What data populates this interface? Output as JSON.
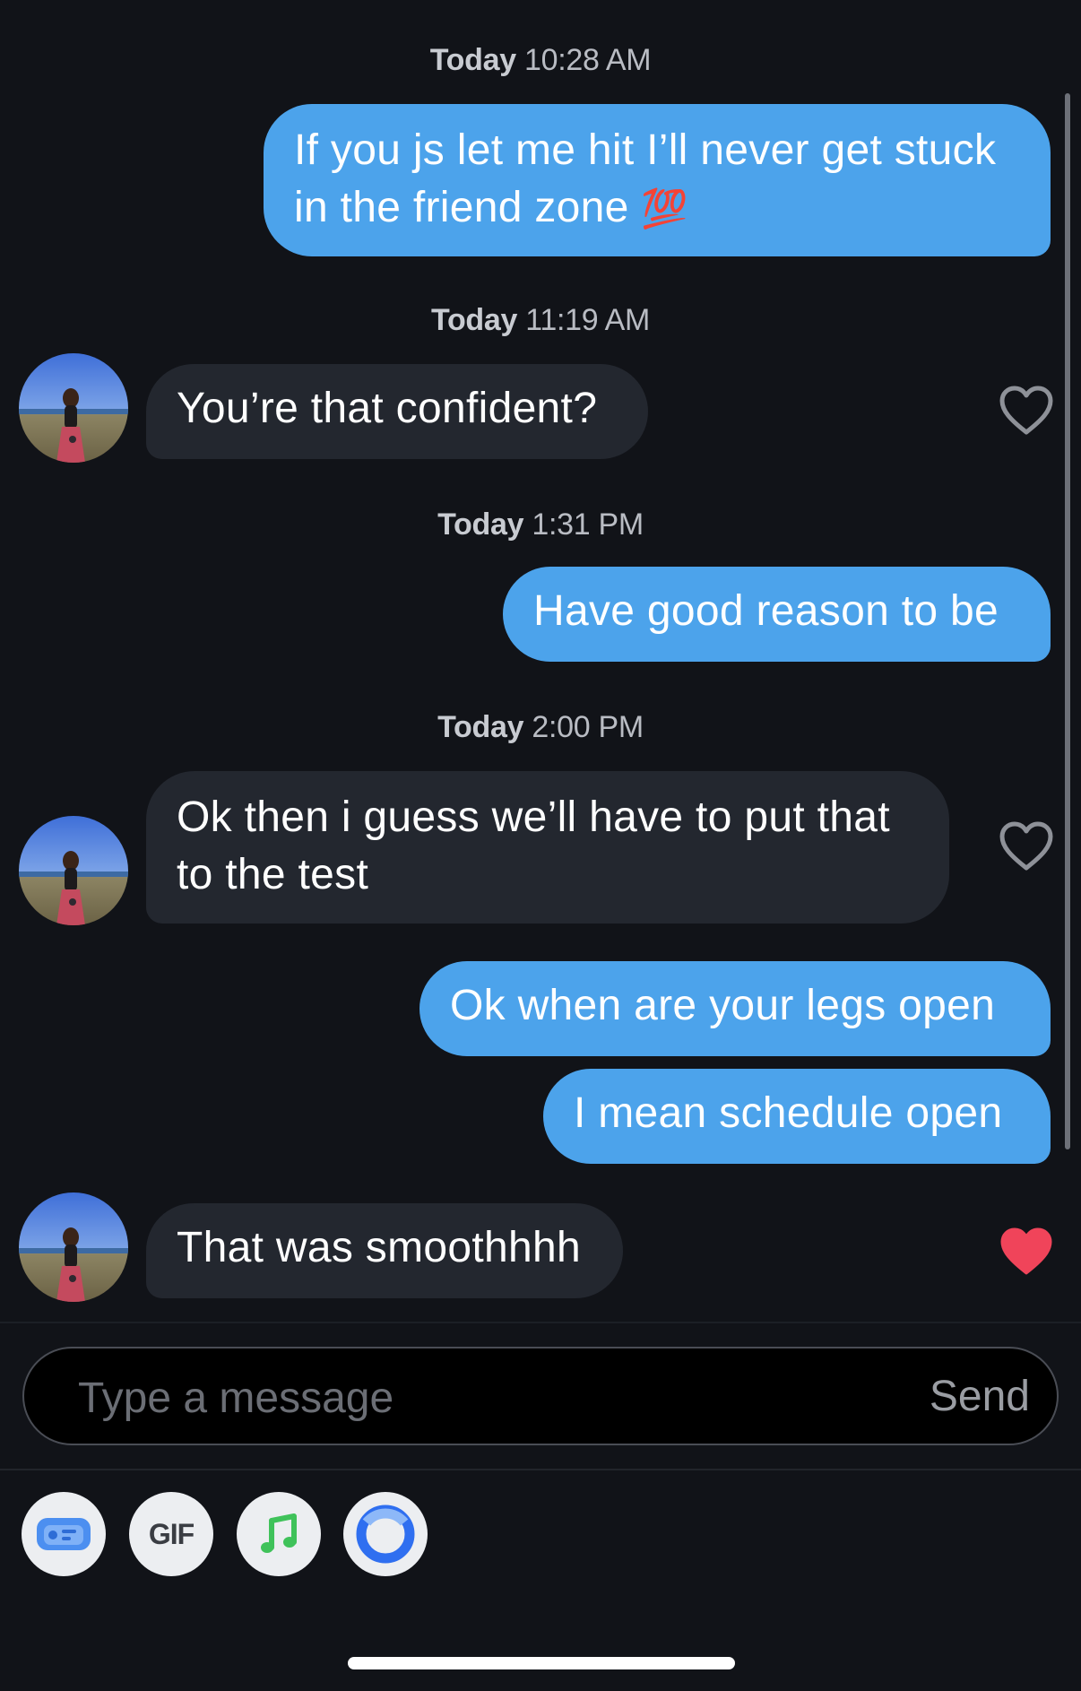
{
  "conversation": {
    "timestamps": [
      {
        "day": "Today",
        "time": "10:28 AM"
      },
      {
        "day": "Today",
        "time": "11:19 AM"
      },
      {
        "day": "Today",
        "time": "1:31 PM"
      },
      {
        "day": "Today",
        "time": "2:00 PM"
      }
    ],
    "messages": [
      {
        "side": "outgoing",
        "line1": "If you js let me hit I’ll never get stuck",
        "line2": "in the friend zone",
        "emoji": "💯"
      },
      {
        "side": "incoming",
        "text": "You’re that confident?",
        "liked": false
      },
      {
        "side": "outgoing",
        "text": "Have good reason to be"
      },
      {
        "side": "incoming",
        "line1": "Ok then i guess we’ll have to put that",
        "line2": "to the test",
        "liked": false
      },
      {
        "side": "outgoing",
        "text": "Ok when are your legs open"
      },
      {
        "side": "outgoing",
        "text": "I mean schedule open"
      },
      {
        "side": "incoming",
        "text": "That was smoothhhh",
        "liked": true
      }
    ]
  },
  "composer": {
    "placeholder": "Type a message",
    "send_label": "Send"
  },
  "toolbar": {
    "gif_label": "GIF",
    "icons": [
      "card-icon",
      "gif-icon",
      "music-icon",
      "ring-icon"
    ]
  },
  "colors": {
    "outgoing_bubble": "#4ca3eb",
    "incoming_bubble": "#23272f",
    "liked_heart": "#f0445a",
    "background": "#111318"
  }
}
